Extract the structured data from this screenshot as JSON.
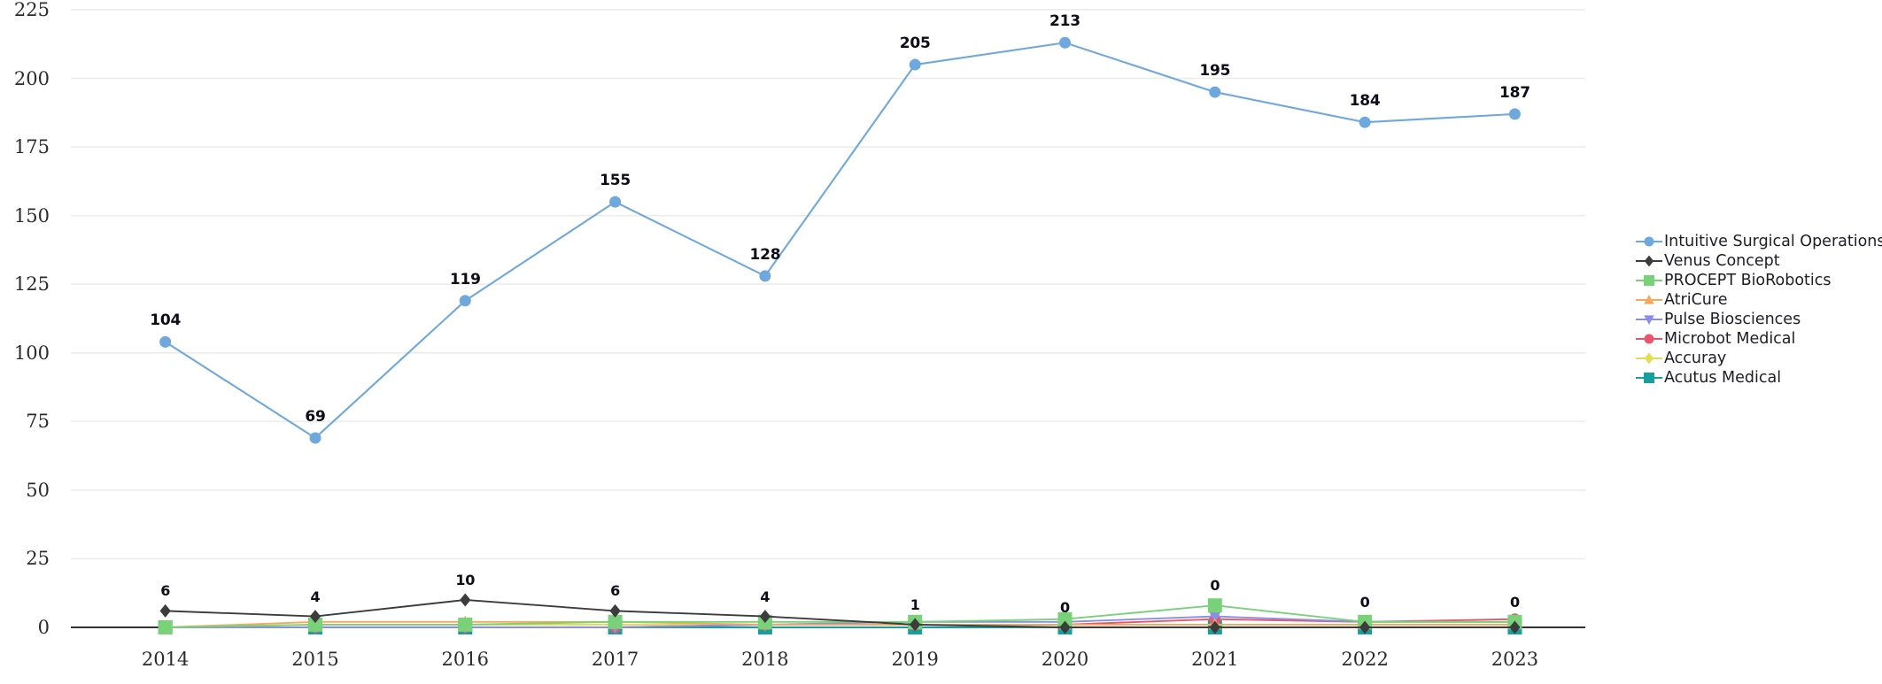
{
  "chart_data": {
    "type": "line",
    "title": "",
    "subtitle": "",
    "xlabel": "",
    "ylabel": "",
    "categories": [
      "2014",
      "2015",
      "2016",
      "2017",
      "2018",
      "2019",
      "2020",
      "2021",
      "2022",
      "2023"
    ],
    "ylim": [
      0,
      225
    ],
    "yticks": [
      0,
      25,
      50,
      75,
      100,
      125,
      150,
      175,
      200,
      225
    ],
    "ytick_labels": [
      "0",
      "25",
      "50",
      "75",
      "100",
      "125",
      "150",
      "175",
      "200",
      "225"
    ],
    "grid": true,
    "grid_axis": "y",
    "legend_position": "right",
    "series": [
      {
        "name": "Intuitive Surgical Operations",
        "color": "#6fa8dc",
        "marker": "circle",
        "values": [
          104,
          69,
          119,
          155,
          128,
          205,
          213,
          195,
          184,
          187
        ],
        "labels": [
          "104",
          "69",
          "119",
          "155",
          "128",
          "205",
          "213",
          "195",
          "184",
          "187"
        ],
        "label_shown": [
          true,
          true,
          true,
          true,
          true,
          true,
          true,
          true,
          true,
          true
        ]
      },
      {
        "name": "Venus Concept",
        "color": "#3c3c3c",
        "marker": "diamond",
        "values": [
          6,
          4,
          10,
          6,
          4,
          1,
          0,
          0,
          0,
          0
        ],
        "labels": [
          "6",
          "4",
          "10",
          "6",
          "4",
          "1",
          "0",
          "0",
          "0",
          "0"
        ],
        "label_shown": [
          true,
          true,
          true,
          true,
          true,
          true,
          true,
          false,
          false,
          false
        ]
      },
      {
        "name": "PROCEPT BioRobotics",
        "color": "#79d279",
        "marker": "square",
        "values": [
          0,
          1,
          1,
          2,
          2,
          2,
          3,
          8,
          2,
          2
        ],
        "labels": [
          "0",
          "1",
          "1",
          "2",
          "2",
          "2",
          "3",
          "0",
          "0",
          "0"
        ],
        "label_shown": [
          false,
          false,
          false,
          false,
          false,
          false,
          false,
          true,
          true,
          true
        ]
      },
      {
        "name": "AtriCure",
        "color": "#f5a95e",
        "marker": "triangle-up",
        "values": [
          0,
          2,
          2,
          2,
          1,
          1,
          1,
          1,
          1,
          1
        ],
        "labels": [
          "0",
          "2",
          "2",
          "2",
          "1",
          "1",
          "1",
          "1",
          "1",
          "1"
        ],
        "label_shown": [
          false,
          false,
          false,
          false,
          false,
          false,
          false,
          false,
          false,
          false
        ]
      },
      {
        "name": "Pulse Biosciences",
        "color": "#8b8fe0",
        "marker": "triangle-down",
        "values": [
          0,
          0,
          0,
          0,
          1,
          2,
          2,
          4,
          2,
          2
        ],
        "labels": [
          "0",
          "0",
          "0",
          "0",
          "1",
          "2",
          "2",
          "4",
          "2",
          "2"
        ],
        "label_shown": [
          false,
          false,
          false,
          false,
          false,
          false,
          false,
          false,
          false,
          false
        ]
      },
      {
        "name": "Microbot Medical",
        "color": "#e8556e",
        "marker": "circle",
        "values": [
          0,
          0,
          0,
          0,
          1,
          1,
          1,
          3,
          2,
          3
        ],
        "labels": [
          "0",
          "0",
          "0",
          "0",
          "1",
          "1",
          "1",
          "3",
          "2",
          "3"
        ],
        "label_shown": [
          false,
          false,
          false,
          false,
          false,
          false,
          false,
          false,
          false,
          false
        ]
      },
      {
        "name": "Accuray",
        "color": "#e2dd52",
        "marker": "diamond",
        "values": [
          0,
          1,
          1,
          1,
          1,
          1,
          1,
          1,
          1,
          1
        ],
        "labels": [
          "0",
          "1",
          "1",
          "1",
          "1",
          "1",
          "1",
          "1",
          "1",
          "1"
        ],
        "label_shown": [
          false,
          false,
          false,
          false,
          false,
          false,
          false,
          false,
          false,
          false
        ]
      },
      {
        "name": "Acutus Medical",
        "color": "#179e9e",
        "marker": "square",
        "values": [
          0,
          0,
          0,
          0,
          0,
          0,
          0,
          0,
          0,
          0
        ],
        "labels": [
          "0",
          "0",
          "0",
          "0",
          "0",
          "0",
          "0",
          "0",
          "0",
          "0"
        ],
        "label_shown": [
          false,
          false,
          false,
          false,
          false,
          false,
          false,
          false,
          false,
          false
        ]
      }
    ]
  },
  "legend": {
    "items": [
      {
        "label": "Intuitive Surgical Operations",
        "color": "#6fa8dc",
        "marker": "circle"
      },
      {
        "label": "Venus Concept",
        "color": "#3c3c3c",
        "marker": "diamond"
      },
      {
        "label": "PROCEPT BioRobotics",
        "color": "#79d279",
        "marker": "square"
      },
      {
        "label": "AtriCure",
        "color": "#f5a95e",
        "marker": "triangle-up"
      },
      {
        "label": "Pulse Biosciences",
        "color": "#8b8fe0",
        "marker": "triangle-down"
      },
      {
        "label": "Microbot Medical",
        "color": "#e8556e",
        "marker": "circle"
      },
      {
        "label": "Accuray",
        "color": "#e2dd52",
        "marker": "diamond"
      },
      {
        "label": "Acutus Medical",
        "color": "#179e9e",
        "marker": "square"
      }
    ]
  },
  "axes": {
    "y_tick_labels": [
      "225",
      "200",
      "175",
      "150",
      "125",
      "100",
      "75",
      "50",
      "25",
      "0"
    ],
    "x_tick_labels": [
      "2014",
      "2015",
      "2016",
      "2017",
      "2018",
      "2019",
      "2020",
      "2021",
      "2022",
      "2023"
    ]
  }
}
